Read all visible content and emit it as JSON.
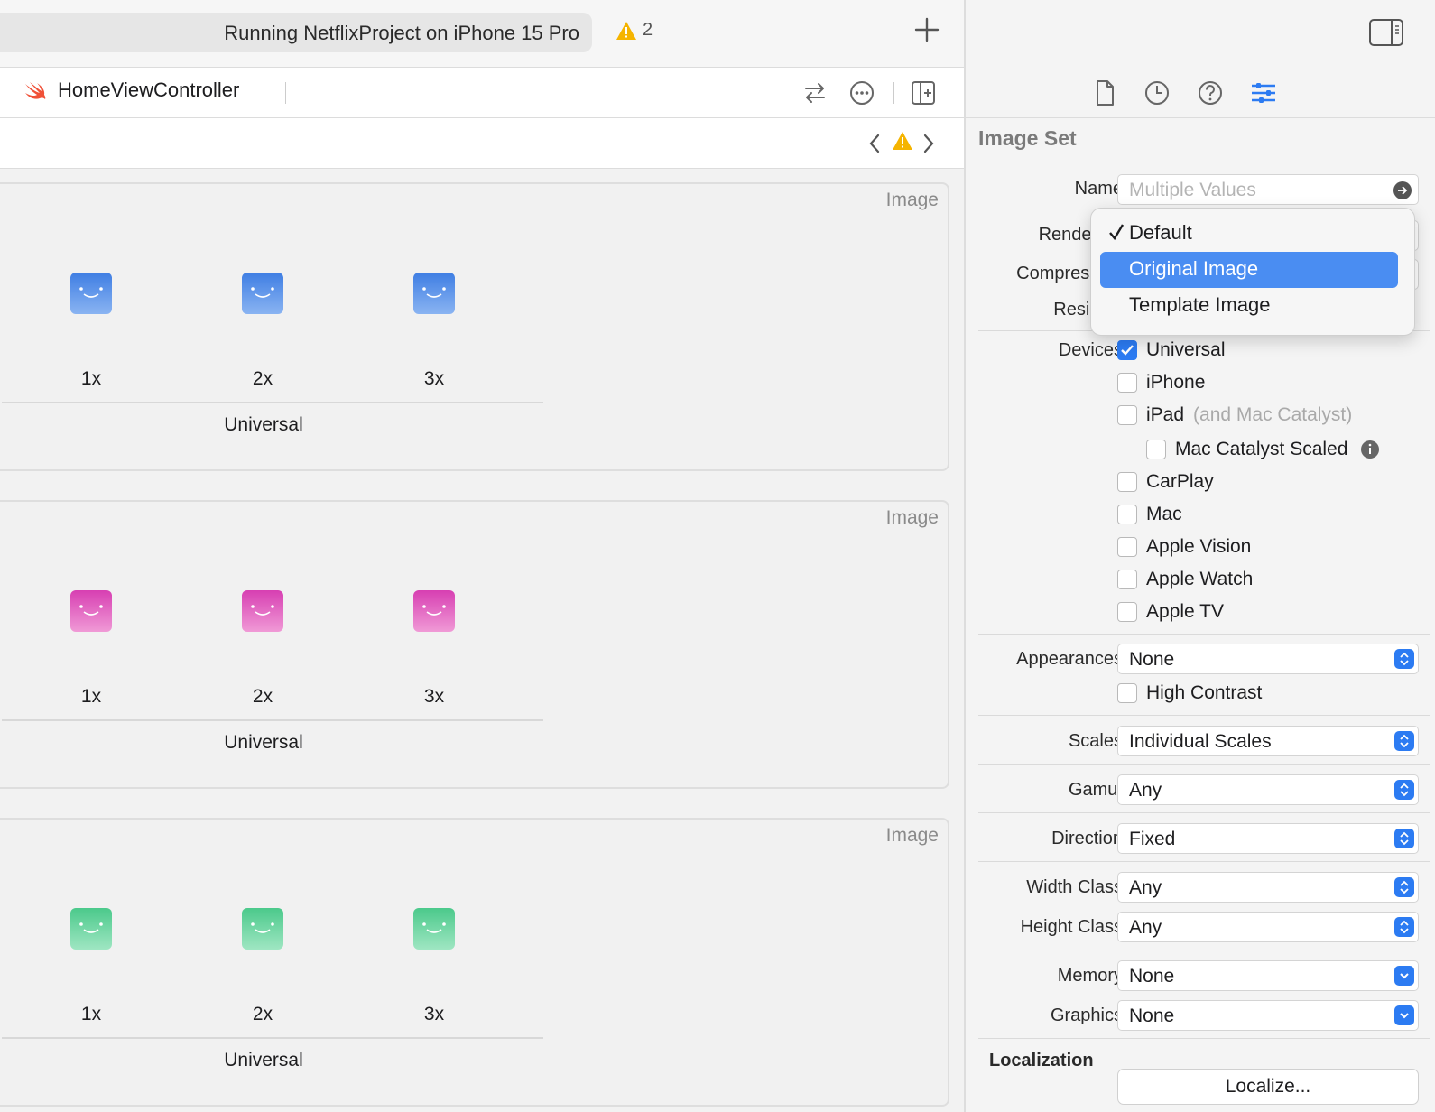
{
  "toolbar": {
    "status_text": "Running NetflixProject on iPhone 15 Pro",
    "warning_count": "2"
  },
  "editor_tab": {
    "title": "HomeViewController"
  },
  "image_sets": [
    {
      "label": "Image",
      "scales": [
        "1x",
        "2x",
        "3x"
      ],
      "group": "Universal",
      "color": "#3f7ee3"
    },
    {
      "label": "Image",
      "scales": [
        "1x",
        "2x",
        "3x"
      ],
      "group": "Universal",
      "color": "#d73fb2"
    },
    {
      "label": "Image",
      "scales": [
        "1x",
        "2x",
        "3x"
      ],
      "group": "Universal",
      "color": "#4bc98b"
    }
  ],
  "inspector": {
    "section_title": "Image Set",
    "name_label": "Name",
    "name_placeholder": "Multiple Values",
    "render_label": "Render As",
    "compression_label": "Compression",
    "resizing_label": "Resizing",
    "devices_label": "Devices",
    "devices": [
      {
        "label": "Universal",
        "checked": true
      },
      {
        "label": "iPhone",
        "checked": false
      },
      {
        "label": "iPad",
        "hint": "(and Mac Catalyst)",
        "checked": false
      },
      {
        "label": "Mac Catalyst Scaled",
        "checked": false
      },
      {
        "label": "CarPlay",
        "checked": false
      },
      {
        "label": "Mac",
        "checked": false
      },
      {
        "label": "Apple Vision",
        "checked": false
      },
      {
        "label": "Apple Watch",
        "checked": false
      },
      {
        "label": "Apple TV",
        "checked": false
      }
    ],
    "appearances_label": "Appearances",
    "appearances_value": "None",
    "high_contrast_label": "High Contrast",
    "scales_label": "Scales",
    "scales_value": "Individual Scales",
    "gamut_label": "Gamut",
    "gamut_value": "Any",
    "direction_label": "Direction",
    "direction_value": "Fixed",
    "width_class_label": "Width Class",
    "width_class_value": "Any",
    "height_class_label": "Height Class",
    "height_class_value": "Any",
    "memory_label": "Memory",
    "memory_value": "None",
    "graphics_label": "Graphics",
    "graphics_value": "None",
    "localization_title": "Localization",
    "localize_button": "Localize..."
  },
  "render_menu": {
    "items": [
      "Default",
      "Original Image",
      "Template Image"
    ],
    "checked_index": 0,
    "highlighted_index": 1
  },
  "colors": {
    "accent": "#2c7bf2",
    "menu_highlight": "#4a8df2",
    "warning": "#f5b400",
    "swift": "#f05138"
  }
}
